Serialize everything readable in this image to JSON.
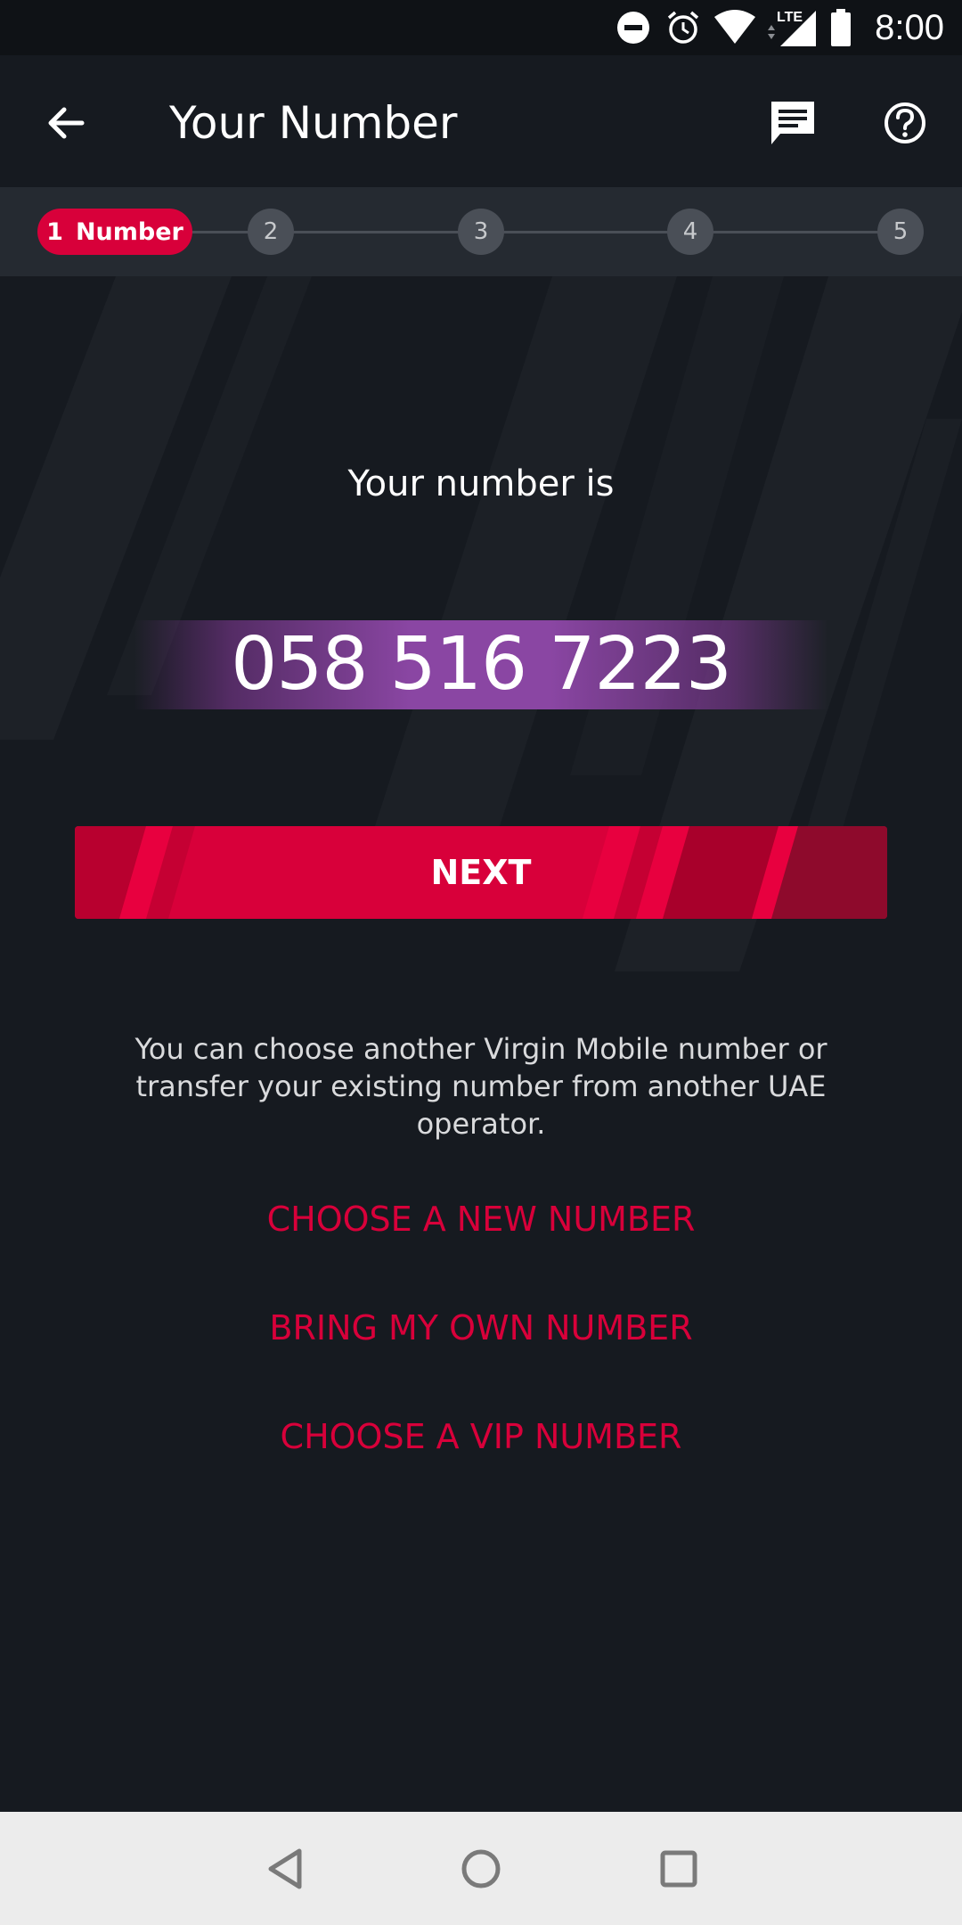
{
  "status_bar": {
    "time": "8:00",
    "network": "LTE",
    "icons": [
      "do-not-disturb-icon",
      "alarm-icon",
      "wifi-icon",
      "lte-signal-icon",
      "battery-icon"
    ]
  },
  "app_bar": {
    "title": "Your Number",
    "back_icon": "arrow-left-icon",
    "chat_icon": "chat-icon",
    "help_icon": "help-circle-icon"
  },
  "stepper": {
    "active_step": {
      "number": "1",
      "label": "Number"
    },
    "steps": [
      "2",
      "3",
      "4",
      "5"
    ]
  },
  "main": {
    "intro": "Your number is",
    "phone_number": "058 516 7223",
    "next_label": "NEXT",
    "info": "You can choose another Virgin Mobile number or transfer your existing number from another UAE operator.",
    "options": [
      "CHOOSE A NEW NUMBER",
      "BRING MY OWN NUMBER",
      "CHOOSE A VIP NUMBER"
    ]
  },
  "nav_bar": {
    "icons": [
      "nav-back-icon",
      "nav-home-icon",
      "nav-recents-icon"
    ]
  },
  "colors": {
    "background": "#161a20",
    "accent": "#d8003a",
    "number_highlight": "#8a46a3",
    "stepper_bg": "#252a31"
  }
}
